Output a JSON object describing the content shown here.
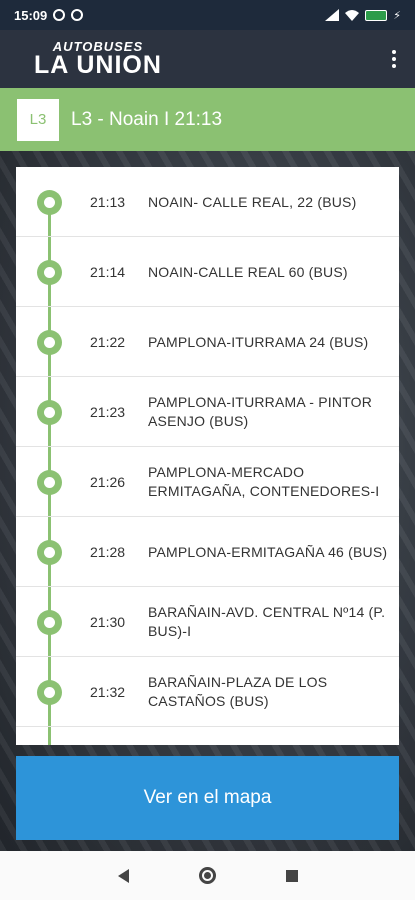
{
  "status_bar": {
    "time": "15:09",
    "battery_label": "100"
  },
  "app_bar": {
    "logo_top": "AUTOBUSES",
    "logo_bottom": "LA UNION",
    "menu_icon": "more-vert-icon"
  },
  "line_header": {
    "badge": "L3",
    "title": "L3 - Noain I 21:13",
    "accent_color": "#8bc172"
  },
  "stops": [
    {
      "time": "21:13",
      "name": "NOAIN- CALLE REAL, 22 (BUS)"
    },
    {
      "time": "21:14",
      "name": "NOAIN-CALLE REAL 60 (BUS)"
    },
    {
      "time": "21:22",
      "name": "PAMPLONA-ITURRAMA 24 (BUS)"
    },
    {
      "time": "21:23",
      "name": "PAMPLONA-ITURRAMA - PINTOR ASENJO (BUS)"
    },
    {
      "time": "21:26",
      "name": "PAMPLONA-MERCADO ERMITAGAÑA, CONTENEDORES-I"
    },
    {
      "time": "21:28",
      "name": "PAMPLONA-ERMITAGAÑA 46 (BUS)"
    },
    {
      "time": "21:30",
      "name": "BARAÑAIN-AVD. CENTRAL Nº14 (P. BUS)-I"
    },
    {
      "time": "21:32",
      "name": "BARAÑAIN-PLAZA DE LOS CASTAÑOS (BUS)"
    }
  ],
  "map_button": {
    "label": "Ver en el mapa",
    "color": "#2d94d9"
  },
  "nav": {
    "back_icon": "back-triangle-icon",
    "home_icon": "home-circle-icon",
    "recent_icon": "recents-square-icon"
  }
}
